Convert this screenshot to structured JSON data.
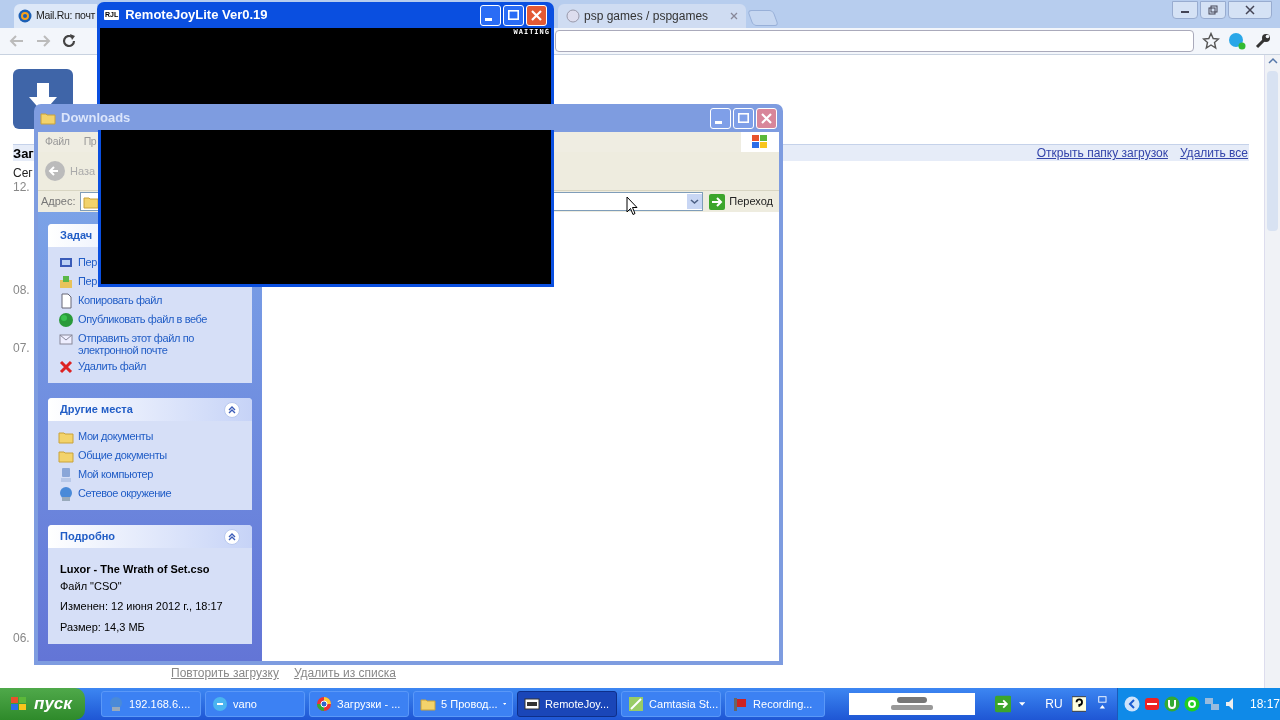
{
  "browser": {
    "tabs": [
      {
        "title": "Mail.Ru: почт"
      },
      {
        "title": "psp games / pspgames"
      }
    ],
    "page": {
      "heading": "Заг",
      "header_links": [
        "Открыть папку загрузок",
        "Удалить все"
      ],
      "dates": [
        {
          "text": "Сег",
          "kind": "label"
        },
        {
          "text": "12.",
          "kind": "date"
        },
        {
          "text": "08.",
          "kind": "date"
        },
        {
          "text": "07.",
          "kind": "date"
        },
        {
          "text": "06.",
          "kind": "date"
        }
      ],
      "item_links": [
        "Повторить загрузку",
        "Удалить из списка"
      ]
    }
  },
  "explorer": {
    "title": "Downloads",
    "menu": [
      "Файл",
      "Пр"
    ],
    "back": "Наза",
    "address_label": "Адрес:",
    "go": "Переход",
    "panels": [
      {
        "title": "Задач",
        "items": [
          {
            "label": "Пер",
            "kind": "monitor"
          },
          {
            "label": "Пер",
            "kind": "move"
          },
          {
            "label": "Копировать файл",
            "kind": "copy"
          },
          {
            "label": "Опубликовать файл в вебе",
            "kind": "globe"
          },
          {
            "label": "Отправить этот файл по электронной почте",
            "kind": "mail"
          },
          {
            "label": "Удалить файл",
            "kind": "delete"
          }
        ]
      },
      {
        "title": "Другие места",
        "collapse": true,
        "items": [
          {
            "label": "Мои документы",
            "kind": "folder"
          },
          {
            "label": "Общие документы",
            "kind": "folder"
          },
          {
            "label": "Мой компьютер",
            "kind": "computer"
          },
          {
            "label": "Сетевое окружение",
            "kind": "network"
          }
        ]
      },
      {
        "title": "Подробно",
        "collapse": true,
        "details": {
          "name": "Luxor - The Wrath of Set.cso",
          "type": "Файл \"CSO\"",
          "lines": [
            "Изменен: 12 июня 2012 г., 18:17",
            "Размер: 14,3 МБ"
          ]
        }
      }
    ]
  },
  "remotejoy": {
    "title": "RemoteJoyLite Ver0.19",
    "icon_text": "RJL",
    "status": "WAITING"
  },
  "taskbar": {
    "start": "пуск",
    "items": [
      {
        "label": "192.168.6....",
        "kind": "network",
        "selected": false
      },
      {
        "label": "vano",
        "kind": "chat",
        "selected": false
      },
      {
        "label": "Загрузки - ...",
        "kind": "browser",
        "selected": false
      },
      {
        "label": "5 Провод...",
        "kind": "folder",
        "selected": false,
        "group": true
      },
      {
        "label": "RemoteJoy...",
        "kind": "rjl",
        "selected": true
      },
      {
        "label": "Camtasia St...",
        "kind": "camtasia",
        "selected": false
      },
      {
        "label": "Recording...",
        "kind": "record",
        "selected": false
      }
    ],
    "language": "RU",
    "clock": "18:17"
  }
}
